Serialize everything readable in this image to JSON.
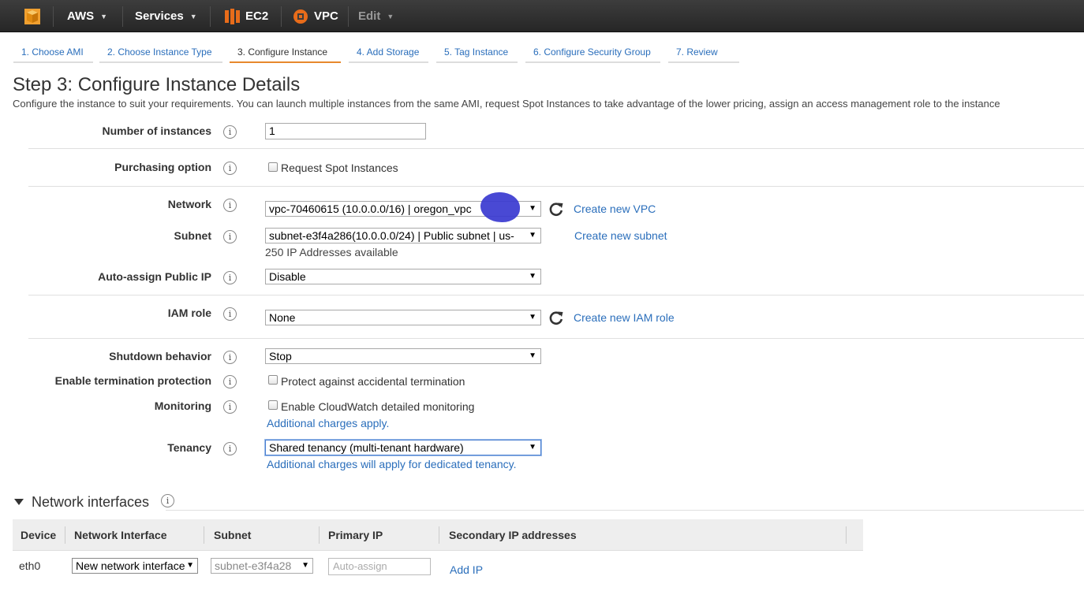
{
  "topnav": {
    "aws": "AWS",
    "services": "Services",
    "ec2": "EC2",
    "vpc": "VPC",
    "edit": "Edit"
  },
  "wizard": {
    "steps": [
      "1. Choose AMI",
      "2. Choose Instance Type",
      "3. Configure Instance",
      "4. Add Storage",
      "5. Tag Instance",
      "6. Configure Security Group",
      "7. Review"
    ],
    "active_index": 2
  },
  "page": {
    "title": "Step 3: Configure Instance Details",
    "description": "Configure the instance to suit your requirements. You can launch multiple instances from the same AMI, request Spot Instances to take advantage of the lower pricing, assign an access management role to the instance"
  },
  "form": {
    "number_of_instances": {
      "label": "Number of instances",
      "value": "1"
    },
    "purchasing_option": {
      "label": "Purchasing option",
      "checkbox": "Request Spot Instances",
      "checked": false
    },
    "network": {
      "label": "Network",
      "value": "vpc-70460615 (10.0.0.0/16) | oregon_vpc",
      "link": "Create new VPC"
    },
    "subnet": {
      "label": "Subnet",
      "value": "subnet-e3f4a286(10.0.0.0/24) | Public subnet | us-",
      "link": "Create new subnet",
      "note": "250 IP Addresses available"
    },
    "public_ip": {
      "label": "Auto-assign Public IP",
      "value": "Disable"
    },
    "iam_role": {
      "label": "IAM role",
      "value": "None",
      "link": "Create new IAM role"
    },
    "shutdown": {
      "label": "Shutdown behavior",
      "value": "Stop"
    },
    "termination": {
      "label": "Enable termination protection",
      "checkbox": "Protect against accidental termination",
      "checked": false
    },
    "monitoring": {
      "label": "Monitoring",
      "checkbox": "Enable CloudWatch detailed monitoring",
      "checked": false,
      "note": "Additional charges apply."
    },
    "tenancy": {
      "label": "Tenancy",
      "value": "Shared tenancy (multi-tenant hardware)",
      "note": "Additional charges will apply for dedicated tenancy."
    }
  },
  "network_interfaces": {
    "title": "Network interfaces",
    "columns": [
      "Device",
      "Network Interface",
      "Subnet",
      "Primary IP",
      "Secondary IP addresses"
    ],
    "rows": [
      {
        "device": "eth0",
        "interface": "New network interface",
        "subnet": "subnet-e3f4a28",
        "primary_ip_placeholder": "Auto-assign",
        "secondary": "Add IP"
      }
    ]
  },
  "colors": {
    "link": "#2a6ebb",
    "active_tab": "#e7882c",
    "topbar": "#262626"
  }
}
